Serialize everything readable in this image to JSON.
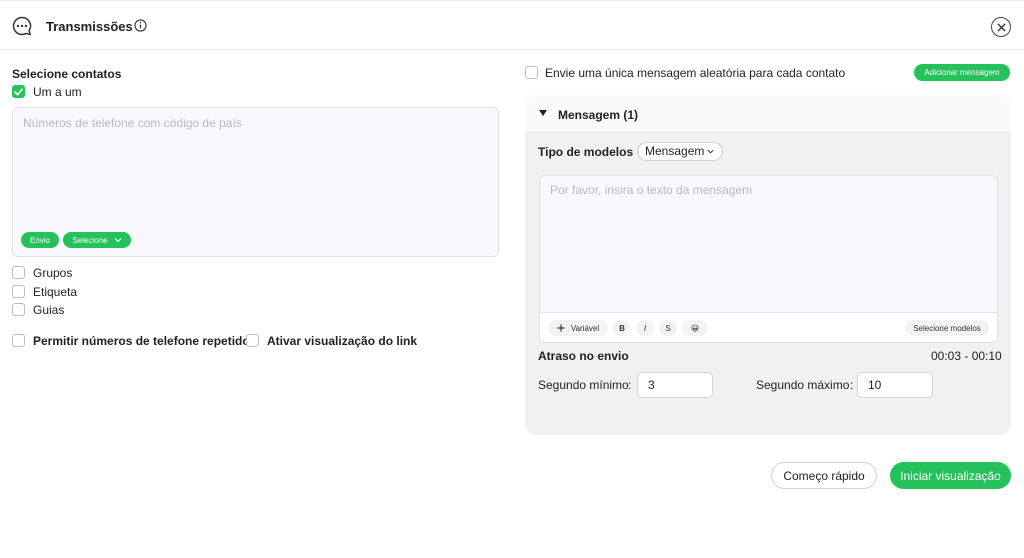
{
  "header": {
    "title": "Transmissões",
    "icon": "chat-bubble-icon",
    "info_icon": "info-icon",
    "close_icon": "close-icon"
  },
  "left": {
    "select_contacts_label": "Selecione contatos",
    "one_by_one": {
      "label": "Um a um",
      "checked": true
    },
    "phone_placeholder": "Números de telefone com código de país",
    "send_pill": "Envio",
    "select_pill": "Selecione",
    "options": [
      {
        "label": "Grupos",
        "checked": false
      },
      {
        "label": "Etiqueta",
        "checked": false
      },
      {
        "label": "Guias",
        "checked": false
      }
    ],
    "allow_repeated": {
      "label": "Permitir números de telefone repetidos",
      "checked": false
    },
    "link_preview": {
      "label": "Ativar visualização do link",
      "checked": false
    }
  },
  "right": {
    "random_message": {
      "label": "Envie uma única mensagem aleatória para cada contato",
      "checked": false
    },
    "add_message_button": "Adicionar mensagem",
    "panel": {
      "title": "Mensagem (1)",
      "template_type_label": "Tipo de modelos",
      "template_type_value": "Mensagem",
      "message_placeholder": "Por favor, insira o texto da mensagem",
      "toolbar": {
        "variable": "Variável",
        "bold": "B",
        "italic": "I",
        "strike": "S",
        "emoji": "😀",
        "select_templates": "Selecione modelos"
      },
      "delay_label": "Atraso no envio",
      "delay_range": "00:03 - 00:10",
      "min_label": "Segundo mínimo",
      "min_value": "3",
      "max_label": "Segundo máximo",
      "max_value": "10"
    }
  },
  "footer": {
    "quick_start": "Começo rápido",
    "start_preview": "Iniciar visualização"
  },
  "colors": {
    "accent": "#25c15a",
    "panel_bg": "#f1f1f1",
    "textarea_bg": "#f8f8fd"
  }
}
